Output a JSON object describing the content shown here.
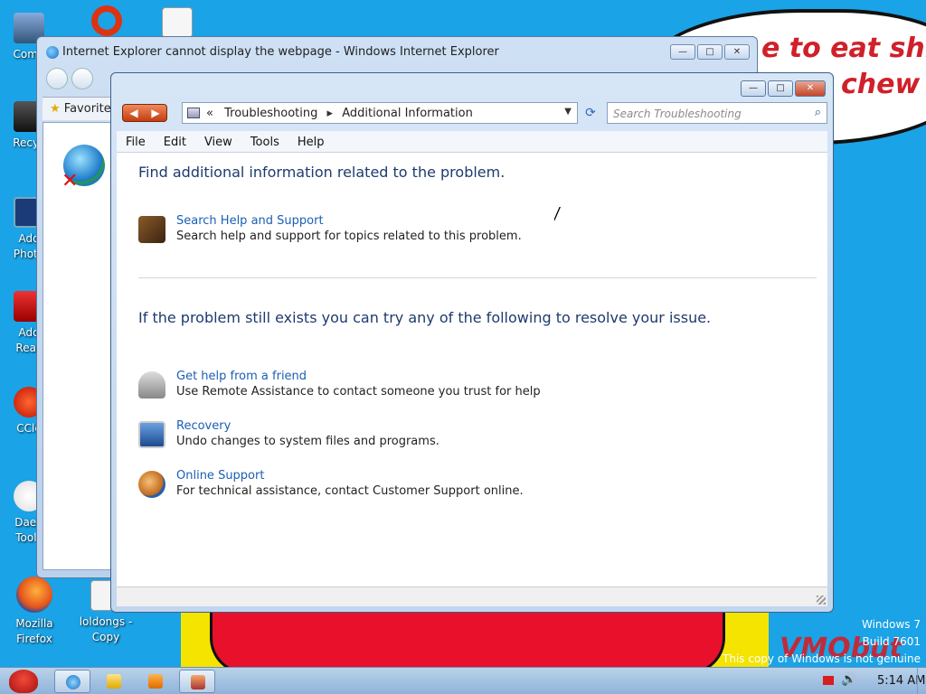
{
  "wallpaper": {
    "bubble_line1": "e to eat shit",
    "bubble_line2": "chew",
    "watermark_os": "Windows 7",
    "watermark_build": "Build 7601",
    "watermark_genuine": "This copy of Windows is not genuine",
    "vmobut": "VMObut"
  },
  "desktop": {
    "icons": [
      {
        "label1": "Comp",
        "label2": ""
      },
      {
        "label1": "Recyc",
        "label2": ""
      },
      {
        "label1": "Ado",
        "label2": "Photo"
      },
      {
        "label1": "Ado",
        "label2": "Reac"
      },
      {
        "label1": "CCle",
        "label2": ""
      },
      {
        "label1": "Daen",
        "label2": "Tools"
      },
      {
        "label1": "Mozilla",
        "label2": "Firefox"
      },
      {
        "label1": "loldongs -",
        "label2": "Copy"
      }
    ]
  },
  "ie_window": {
    "title": "Internet Explorer cannot display the webpage - Windows Internet Explorer",
    "favorites_label": "Favorite",
    "controls": {
      "min": "—",
      "max": "□",
      "close": "✕"
    }
  },
  "ts_window": {
    "controls": {
      "min": "—",
      "max": "□",
      "close": "✕"
    },
    "nav": {
      "back": "◀",
      "forward": "▶"
    },
    "breadcrumb": {
      "prefix": "«",
      "item1": "Troubleshooting",
      "sep": "▸",
      "item2": "Additional Information",
      "dropdown": "▼"
    },
    "refresh": "⟳",
    "search": {
      "placeholder": "Search Troubleshooting",
      "icon": "⌕"
    },
    "menu": [
      "File",
      "Edit",
      "View",
      "Tools",
      "Help"
    ],
    "heading1": "Find additional information related to the problem.",
    "heading2": "If the problem still exists you can try any of the following to resolve your issue.",
    "tasks": [
      {
        "link": "Search Help and Support",
        "desc": "Search help and support for topics related to this problem.",
        "icon": "help-book-icon"
      },
      {
        "link": "Get help from a friend",
        "desc": "Use Remote Assistance to contact someone you trust for help",
        "icon": "remote-assistance-icon"
      },
      {
        "link": "Recovery",
        "desc": "Undo changes to system files and programs.",
        "icon": "recovery-icon"
      },
      {
        "link": "Online Support",
        "desc": "For technical assistance, contact Customer Support online.",
        "icon": "online-support-icon"
      }
    ]
  },
  "taskbar": {
    "clock": "5:14 AM",
    "speaker": "🔊"
  },
  "colors": {
    "desktop_bg": "#1aa3e6",
    "heading": "#1e3a6e",
    "link": "#1a5fb4"
  }
}
